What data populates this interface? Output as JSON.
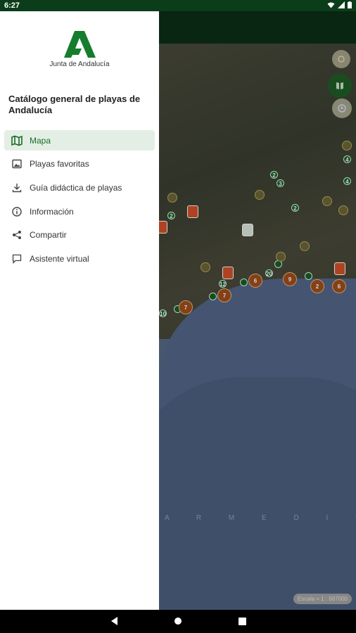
{
  "status_bar": {
    "time": "6:27",
    "icons": [
      "wifi-icon",
      "signal-icon",
      "battery-icon"
    ]
  },
  "drawer": {
    "logo_text": "Junta de Andalucía",
    "title": "Catálogo general de playas de Andalucía",
    "menu": [
      {
        "label": "Mapa",
        "icon": "map-icon",
        "active": true
      },
      {
        "label": "Playas favoritas",
        "icon": "image-icon",
        "active": false
      },
      {
        "label": "Guía didáctica de playas",
        "icon": "download-icon",
        "active": false
      },
      {
        "label": "Información",
        "icon": "info-icon",
        "active": false
      },
      {
        "label": "Compartir",
        "icon": "share-icon",
        "active": false
      },
      {
        "label": "Asistente virtual",
        "icon": "chat-icon",
        "active": false
      }
    ]
  },
  "map": {
    "sea_label": "A R   M E D I T E R R A",
    "scale_text": "Escala = 1 : 567000",
    "markers": [
      {
        "kind": "green",
        "label": "2"
      },
      {
        "kind": "green",
        "label": "3"
      },
      {
        "kind": "green",
        "label": "2"
      },
      {
        "kind": "green",
        "label": "2"
      },
      {
        "kind": "green",
        "label": "4"
      },
      {
        "kind": "green",
        "label": "4"
      },
      {
        "kind": "green",
        "label": "12"
      },
      {
        "kind": "green",
        "label": "20"
      },
      {
        "kind": "green",
        "label": "10"
      },
      {
        "kind": "brown",
        "label": "6"
      },
      {
        "kind": "brown",
        "label": "7"
      },
      {
        "kind": "brown",
        "label": "7"
      },
      {
        "kind": "brown",
        "label": "9"
      },
      {
        "kind": "brown",
        "label": "2"
      },
      {
        "kind": "brown",
        "label": "6"
      }
    ]
  },
  "colors": {
    "accent": "#1f6b2a",
    "toolbar": "#0c2f16",
    "active_bg": "#e3efe4"
  }
}
